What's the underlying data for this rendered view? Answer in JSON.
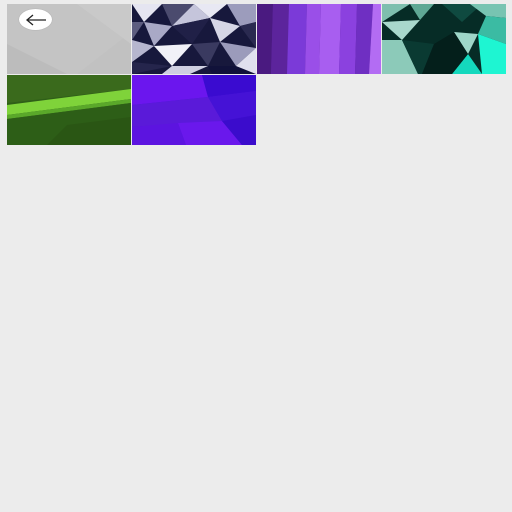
{
  "screen": {
    "background": "#ececec"
  },
  "toolbar": {
    "back_icon": "arrow-left-icon"
  },
  "wallpapers": [
    {
      "name": "gray-blank",
      "colors": [
        "#bdbdbd",
        "#c6c6c6"
      ]
    },
    {
      "name": "navy-triangles",
      "colors": [
        "#15163a",
        "#a8a8c6",
        "#e6e6f2"
      ]
    },
    {
      "name": "purple-stripes",
      "colors": [
        "#4a1a80",
        "#7b3ad8",
        "#b36cf3"
      ]
    },
    {
      "name": "teal-polygons",
      "colors": [
        "#062c26",
        "#5ea996",
        "#1ef5d2"
      ]
    },
    {
      "name": "green-band",
      "colors": [
        "#2d5e17",
        "#7fd33a"
      ]
    },
    {
      "name": "violet-waves",
      "colors": [
        "#3a0bd0",
        "#7019ee",
        "#5a1ad9"
      ]
    }
  ]
}
